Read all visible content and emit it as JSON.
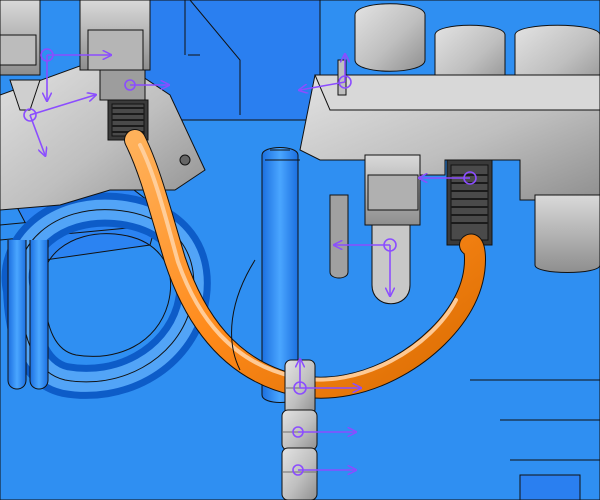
{
  "scene": {
    "description_visible_text": [],
    "colors": {
      "background": "#2f8ff2",
      "frame_blue_dark": "#1c6fd6",
      "frame_blue_light": "#5fb0ff",
      "metal_light": "#c9c9c9",
      "metal_mid": "#a7a7a7",
      "metal_dark": "#6f6f6f",
      "hose_orange": "#ff8a1a",
      "hose_orange_dark": "#d86b00",
      "annotation_purple": "#8b4dff",
      "edge_black": "#111111"
    }
  }
}
